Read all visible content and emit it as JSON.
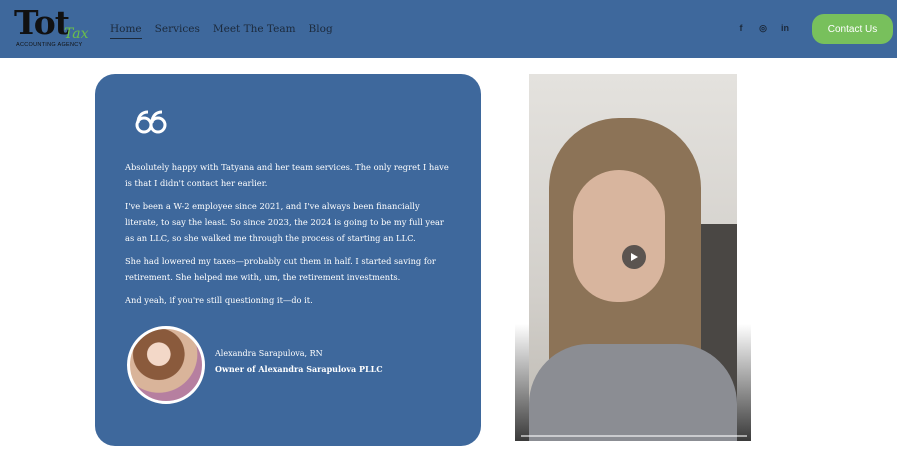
{
  "brand": {
    "logo_main": "Tot",
    "logo_script": "Tax",
    "logo_sub": "ACCOUNTING AGENCY",
    "accent_color": "#3e689c",
    "button_color": "#78c05c"
  },
  "nav": {
    "items": [
      {
        "label": "Home",
        "active": true
      },
      {
        "label": "Services",
        "active": false
      },
      {
        "label": "Meet The Team",
        "active": false
      },
      {
        "label": "Blog",
        "active": false
      }
    ]
  },
  "social": {
    "facebook": "f",
    "instagram": "◎",
    "linkedin": "in",
    "icons": [
      "facebook-icon",
      "instagram-icon",
      "linkedin-icon"
    ]
  },
  "header": {
    "contact_label": "Contact Us"
  },
  "testimonial": {
    "quote_icon": "quote-icon",
    "paragraphs": [
      "Absolutely happy with Tatyana and her team services. The only regret I have is that I didn't contact her earlier.",
      "I've been a W-2 employee since 2021, and I've always been financially literate, to say the least. So since 2023, the 2024 is going to be my full year as an LLC, so she walked me through the process of starting an LLC.",
      "She had lowered my taxes—probably cut them in half. I started saving for retirement. She helped me with, um, the retirement investments.",
      "And yeah, if you're still questioning it—do it."
    ],
    "author_name": "Alexandra Sarapulova, RN",
    "author_title": "Owner of Alexandra Sarapulova PLLC"
  },
  "video": {
    "play_icon": "play-icon"
  }
}
